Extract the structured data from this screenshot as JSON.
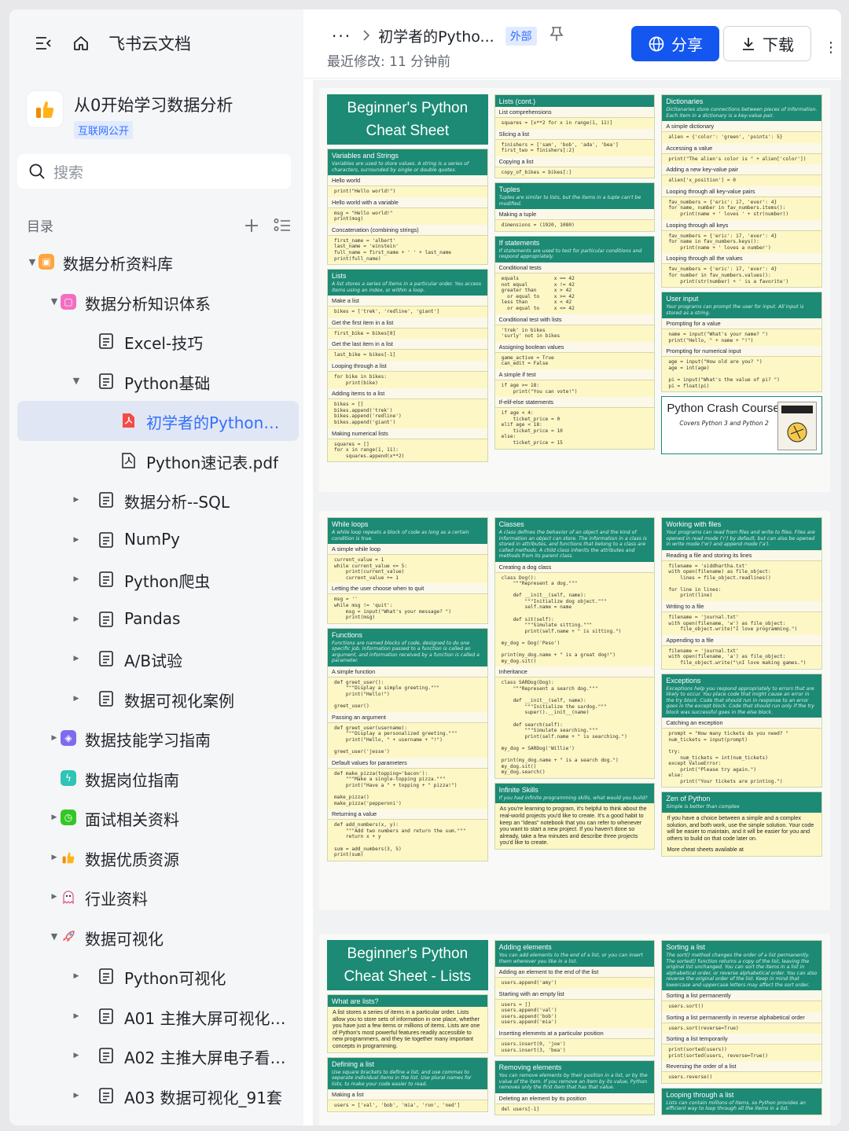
{
  "sidebar": {
    "brand": "飞书云文档",
    "workspace": {
      "title": "从0开始学习数据分析",
      "tag": "互联网公开"
    },
    "search_placeholder": "搜索",
    "toc_label": "目录",
    "tree": [
      {
        "label": "数据分析资料库",
        "level": 0,
        "arrow": "down",
        "icon": "folder-orange-icon"
      },
      {
        "label": "数据分析知识体系",
        "level": 1,
        "arrow": "down",
        "icon": "pink-square-icon"
      },
      {
        "label": "Excel-技巧",
        "level": 2,
        "arrow": "",
        "icon": "doc-icon"
      },
      {
        "label": "Python基础",
        "level": 2,
        "arrow": "down",
        "icon": "doc-icon"
      },
      {
        "label": "初学者的Python备忘...",
        "level": 3,
        "arrow": "",
        "icon": "pdf-red-icon",
        "active": true
      },
      {
        "label": "Python速记表.pdf",
        "level": 3,
        "arrow": "",
        "icon": "pdf-icon"
      },
      {
        "label": "数据分析--SQL",
        "level": 2,
        "arrow": "right",
        "icon": "doc-icon"
      },
      {
        "label": "NumPy",
        "level": 2,
        "arrow": "right",
        "icon": "doc-icon"
      },
      {
        "label": "Python爬虫",
        "level": 2,
        "arrow": "right",
        "icon": "doc-icon"
      },
      {
        "label": "Pandas",
        "level": 2,
        "arrow": "right",
        "icon": "doc-icon"
      },
      {
        "label": "A/B试验",
        "level": 2,
        "arrow": "right",
        "icon": "doc-icon"
      },
      {
        "label": "数据可视化案例",
        "level": 2,
        "arrow": "right",
        "icon": "doc-icon"
      },
      {
        "label": "数据技能学习指南",
        "level": 1,
        "arrow": "right",
        "icon": "purple-layers-icon"
      },
      {
        "label": "数据岗位指南",
        "level": 1,
        "arrow": "",
        "icon": "green-bolt-icon"
      },
      {
        "label": "面试相关资料",
        "level": 1,
        "arrow": "right",
        "icon": "green-clock-icon"
      },
      {
        "label": "数据优质资源",
        "level": 1,
        "arrow": "right",
        "icon": "thumbs-up-icon"
      },
      {
        "label": "行业资料",
        "level": 1,
        "arrow": "right",
        "icon": "ghost-icon"
      },
      {
        "label": "数据可视化",
        "level": 1,
        "arrow": "down",
        "icon": "rocket-icon"
      },
      {
        "label": "Python可视化",
        "level": 2,
        "arrow": "right",
        "icon": "doc-icon"
      },
      {
        "label": "A01 主推大屏可视化模...",
        "level": 2,
        "arrow": "right",
        "icon": "doc-icon"
      },
      {
        "label": "A02 主推大屏电子看板...",
        "level": 2,
        "arrow": "right",
        "icon": "doc-icon"
      },
      {
        "label": "A03 数据可视化_91套",
        "level": 2,
        "arrow": "right",
        "icon": "doc-icon"
      }
    ]
  },
  "header": {
    "title": "初学者的Pytho...",
    "tag": "外部",
    "modified": "最近修改: 11 分钟前",
    "share": "分享",
    "download": "下载"
  },
  "pages": {
    "p1": {
      "banner1": "Beginner's Python",
      "banner2": "Cheat Sheet",
      "col1": [
        {
          "h": "Variables and Strings",
          "sub": "Variables are used to store values. A string is a series of characters, surrounded by single or double quotes.",
          "items": [
            {
              "r": "Hello world",
              "c": "print(\"Hello world!\")"
            },
            {
              "r": "Hello world with a variable",
              "c": "msg = \"Hello world!\"\nprint(msg)"
            },
            {
              "r": "Concatenation (combining strings)",
              "c": "first_name = 'albert'\nlast_name = 'einstein'\nfull_name = first_name + ' ' + last_name\nprint(full_name)"
            }
          ]
        },
        {
          "h": "Lists",
          "sub": "A list stores a series of items in a particular order. You access items using an index, or within a loop.",
          "items": [
            {
              "r": "Make a list",
              "c": "bikes = ['trek', 'redline', 'giant']"
            },
            {
              "r": "Get the first item in a list",
              "c": "first_bike = bikes[0]"
            },
            {
              "r": "Get the last item in a list",
              "c": "last_bike = bikes[-1]"
            },
            {
              "r": "Looping through a list",
              "c": "for bike in bikes:\n    print(bike)"
            },
            {
              "r": "Adding items to a list",
              "c": "bikes = []\nbikes.append('trek')\nbikes.append('redline')\nbikes.append('giant')"
            },
            {
              "r": "Making numerical lists",
              "c": "squares = []\nfor x in range(1, 11):\n    squares.append(x**2)"
            }
          ]
        }
      ],
      "col2": [
        {
          "h": "Lists (cont.)",
          "sub": "",
          "items": [
            {
              "r": "List comprehensions",
              "c": "squares = [x**2 for x in range(1, 11)]"
            },
            {
              "r": "Slicing a list",
              "c": "finishers = ['sam', 'bob', 'ada', 'bea']\nfirst_two = finishers[:2]"
            },
            {
              "r": "Copying a list",
              "c": "copy_of_bikes = bikes[:]"
            }
          ]
        },
        {
          "h": "Tuples",
          "sub": "Tuples are similar to lists, but the items in a tuple can't be modified.",
          "items": [
            {
              "r": "Making a tuple",
              "c": "dimensions = (1920, 1080)"
            }
          ]
        },
        {
          "h": "If statements",
          "sub": "If statements are used to test for particular conditions and respond appropriately.",
          "items": [
            {
              "r": "Conditional tests",
              "c": "equals            x == 42\nnot equal         x != 42\ngreater than      x > 42\n  or equal to     x >= 42\nless than         x < 42\n  or equal to     x <= 42"
            },
            {
              "r": "Conditional test with lists",
              "c": "'trek' in bikes\n'surly' not in bikes"
            },
            {
              "r": "Assigning boolean values",
              "c": "game_active = True\ncan_edit = False"
            },
            {
              "r": "A simple if test",
              "c": "if age >= 18:\n    print(\"You can vote!\")"
            },
            {
              "r": "If-elif-else statements",
              "c": "if age < 4:\n    ticket_price = 0\nelif age < 18:\n    ticket_price = 10\nelse:\n    ticket_price = 15"
            }
          ]
        }
      ],
      "col3": [
        {
          "h": "Dictionaries",
          "sub": "Dictionaries store connections between pieces of information. Each item in a dictionary is a key-value pair.",
          "items": [
            {
              "r": "A simple dictionary",
              "c": "alien = {'color': 'green', 'points': 5}"
            },
            {
              "r": "Accessing a value",
              "c": "print(\"The alien's color is \" + alien['color'])"
            },
            {
              "r": "Adding a new key-value pair",
              "c": "alien['x_position'] = 0"
            },
            {
              "r": "Looping through all key-value pairs",
              "c": "fav_numbers = {'eric': 17, 'ever': 4}\nfor name, number in fav_numbers.items():\n    print(name + ' loves ' + str(number))"
            },
            {
              "r": "Looping through all keys",
              "c": "fav_numbers = {'eric': 17, 'ever': 4}\nfor name in fav_numbers.keys():\n    print(name + ' loves a number')"
            },
            {
              "r": "Looping through all the values",
              "c": "fav_numbers = {'eric': 17, 'ever': 4}\nfor number in fav_numbers.values():\n    print(str(number) + ' is a favorite')"
            }
          ]
        },
        {
          "h": "User input",
          "sub": "Your programs can prompt the user for input. All input is stored as a string.",
          "items": [
            {
              "r": "Prompting for a value",
              "c": "name = input(\"What's your name? \")\nprint(\"Hello, \" + name + \"!\")"
            },
            {
              "r": "Prompting for numerical input",
              "c": "age = input(\"How old are you? \")\nage = int(age)\n\npi = input(\"What's the value of pi? \")\npi = float(pi)"
            }
          ]
        }
      ],
      "pcc_title": "Python Crash Course",
      "pcc_sub": "Covers Python 3 and Python 2"
    },
    "p2": {
      "col1": [
        {
          "h": "While loops",
          "sub": "A while loop repeats a block of code as long as a certain condition is true.",
          "items": [
            {
              "r": "A simple while loop",
              "c": "current_value = 1\nwhile current_value <= 5:\n    print(current_value)\n    current_value += 1"
            },
            {
              "r": "Letting the user choose when to quit",
              "c": "msg = ''\nwhile msg != 'quit':\n    msg = input(\"What's your message? \")\n    print(msg)"
            }
          ]
        },
        {
          "h": "Functions",
          "sub": "Functions are named blocks of code, designed to do one specific job. Information passed to a function is called an argument, and information received by a function is called a parameter.",
          "items": [
            {
              "r": "A simple function",
              "c": "def greet_user():\n    \"\"\"Display a simple greeting.\"\"\"\n    print(\"Hello!\")\n\ngreet_user()"
            },
            {
              "r": "Passing an argument",
              "c": "def greet_user(username):\n    \"\"\"Display a personalized greeting.\"\"\"\n    print(\"Hello, \" + username + \"!\")\n\ngreet_user('jesse')"
            },
            {
              "r": "Default values for parameters",
              "c": "def make_pizza(topping='bacon'):\n    \"\"\"Make a single-topping pizza.\"\"\"\n    print(\"Have a \" + topping + \" pizza!\")\n\nmake_pizza()\nmake_pizza('pepperoni')"
            },
            {
              "r": "Returning a value",
              "c": "def add_numbers(x, y):\n    \"\"\"Add two numbers and return the sum.\"\"\"\n    return x + y\n\nsum = add_numbers(3, 5)\nprint(sum)"
            }
          ]
        }
      ],
      "col2": [
        {
          "h": "Classes",
          "sub": "A class defines the behavior of an object and the kind of information an object can store. The information in a class is stored in attributes, and functions that belong to a class are called methods. A child class inherits the attributes and methods from its parent class.",
          "items": [
            {
              "r": "Creating a dog class",
              "c": "class Dog():\n    \"\"\"Represent a dog.\"\"\"\n\n    def __init__(self, name):\n        \"\"\"Initialize dog object.\"\"\"\n        self.name = name\n\n    def sit(self):\n        \"\"\"Simulate sitting.\"\"\"\n        print(self.name + \" is sitting.\")\n\nmy_dog = Dog('Peso')\n\nprint(my_dog.name + \" is a great dog!\")\nmy_dog.sit()"
            },
            {
              "r": "Inheritance",
              "c": "class SARDog(Dog):\n    \"\"\"Represent a search dog.\"\"\"\n\n    def __init__(self, name):\n        \"\"\"Initialize the sardog.\"\"\"\n        super().__init__(name)\n\n    def search(self):\n        \"\"\"Simulate searching.\"\"\"\n        print(self.name + \" is searching.\")\n\nmy_dog = SARDog('Willie')\n\nprint(my_dog.name + \" is a search dog.\")\nmy_dog.sit()\nmy_dog.search()"
            }
          ]
        },
        {
          "h": "Infinite Skills",
          "sub": "If you had infinite programming skills, what would you build?",
          "items": [
            {
              "p": "As you're learning to program, it's helpful to think about the real-world projects you'd like to create. It's a good habit to keep an \"ideas\" notebook that you can refer to whenever you want to start a new project. If you haven't done so already, take a few minutes and describe three projects you'd like to create."
            }
          ]
        }
      ],
      "col3": [
        {
          "h": "Working with files",
          "sub": "Your programs can read from files and write to files. Files are opened in read mode ('r') by default, but can also be opened in write mode ('w') and append mode ('a').",
          "items": [
            {
              "r": "Reading a file and storing its lines",
              "c": "filename = 'siddhartha.txt'\nwith open(filename) as file_object:\n    lines = file_object.readlines()\n\nfor line in lines:\n    print(line)"
            },
            {
              "r": "Writing to a file",
              "c": "filename = 'journal.txt'\nwith open(filename, 'w') as file_object:\n    file_object.write(\"I love programming.\")"
            },
            {
              "r": "Appending to a file",
              "c": "filename = 'journal.txt'\nwith open(filename, 'a') as file_object:\n    file_object.write(\"\\nI love making games.\")"
            }
          ]
        },
        {
          "h": "Exceptions",
          "sub": "Exceptions help you respond appropriately to errors that are likely to occur. You place code that might cause an error in the try block. Code that should run in response to an error goes in the except block. Code that should run only if the try block was successful goes in the else block.",
          "items": [
            {
              "r": "Catching an exception",
              "c": "prompt = \"How many tickets do you need? \"\nnum_tickets = input(prompt)\n\ntry:\n    num_tickets = int(num_tickets)\nexcept ValueError:\n    print(\"Please try again.\")\nelse:\n    print(\"Your tickets are printing.\")"
            }
          ]
        },
        {
          "h": "Zen of Python",
          "sub": "Simple is better than complex",
          "items": [
            {
              "p": "If you have a choice between a simple and a complex solution, and both work, use the simple solution. Your code will be easier to maintain, and it will be easier for you and others to build on that code later on."
            },
            {
              "p": "More cheat sheets available at"
            }
          ]
        }
      ]
    },
    "p3": {
      "banner1": "Beginner's Python",
      "banner2": "Cheat Sheet - Lists",
      "col1": [
        {
          "h": "What are lists?",
          "sub": "",
          "items": [
            {
              "p": "A list stores a series of items in a particular order. Lists allow you to store sets of information in one place, whether you have just a few items or millions of items. Lists are one of Python's most powerful features readily accessible to new programmers, and they tie together many important concepts in programming."
            }
          ]
        },
        {
          "h": "Defining a list",
          "sub": "Use square brackets to define a list, and use commas to separate individual items in the list. Use plural names for lists, to make your code easier to read.",
          "items": [
            {
              "r": "Making a list",
              "c": "users = ['val', 'bob', 'mia', 'ron', 'ned']"
            }
          ]
        }
      ],
      "col2": [
        {
          "h": "Adding elements",
          "sub": "You can add elements to the end of a list, or you can insert them wherever you like in a list.",
          "items": [
            {
              "r": "Adding an element to the end of the list",
              "c": "users.append('amy')"
            },
            {
              "r": "Starting with an empty list",
              "c": "users = []\nusers.append('val')\nusers.append('bob')\nusers.append('mia')"
            },
            {
              "r": "Inserting elements at a particular position",
              "c": "users.insert(0, 'joe')\nusers.insert(3, 'bea')"
            }
          ]
        },
        {
          "h": "Removing elements",
          "sub": "You can remove elements by their position in a list, or by the value of the item. If you remove an item by its value, Python removes only the first item that has that value.",
          "items": [
            {
              "r": "Deleting an element by its position",
              "c": "del users[-1]"
            }
          ]
        }
      ],
      "col3": [
        {
          "h": "Sorting a list",
          "sub": "The sort() method changes the order of a list permanently. The sorted() function returns a copy of the list, leaving the original list unchanged. You can sort the items in a list in alphabetical order, or reverse alphabetical order. You can also reverse the original order of the list. Keep in mind that lowercase and uppercase letters may affect the sort order.",
          "items": [
            {
              "r": "Sorting a list permanently",
              "c": "users.sort()"
            },
            {
              "r": "Sorting a list permanently in reverse alphabetical order",
              "c": "users.sort(reverse=True)"
            },
            {
              "r": "Sorting a list temporarily",
              "c": "print(sorted(users))\nprint(sorted(users, reverse=True))"
            },
            {
              "r": "Reversing the order of a list",
              "c": "users.reverse()"
            }
          ]
        },
        {
          "h": "Looping through a list",
          "sub": "Lists can contain millions of items, so Python provides an efficient way to loop through all the items in a list.",
          "items": []
        }
      ]
    }
  }
}
